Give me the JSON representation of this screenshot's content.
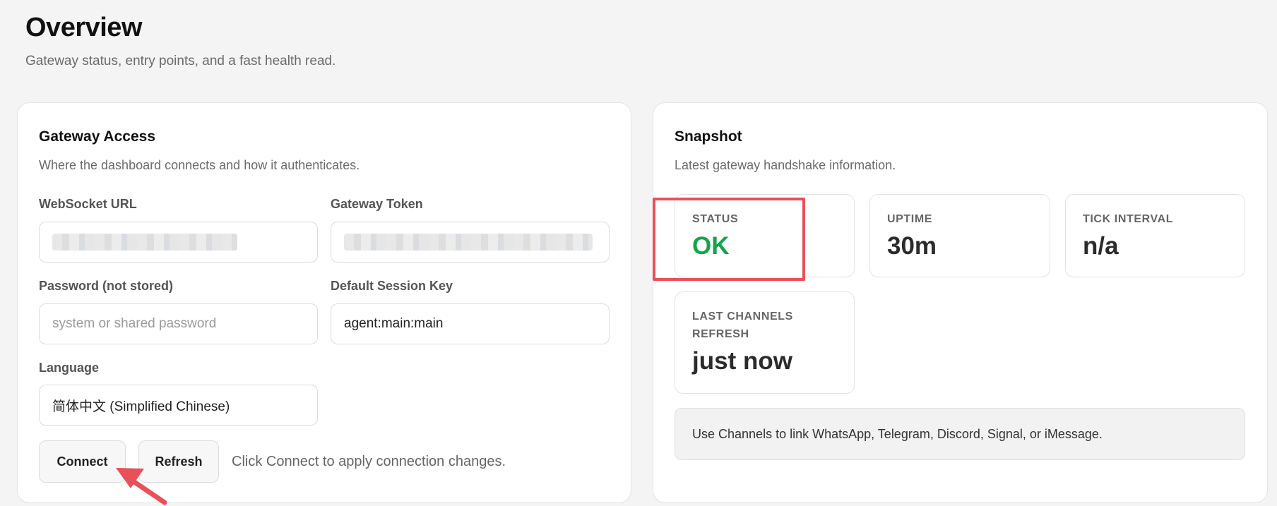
{
  "header": {
    "title": "Overview",
    "subtitle": "Gateway status, entry points, and a fast health read."
  },
  "access": {
    "title": "Gateway Access",
    "subtitle": "Where the dashboard connects and how it authenticates.",
    "websocket_label": "WebSocket URL",
    "token_label": "Gateway Token",
    "password_label": "Password (not stored)",
    "password_placeholder": "system or shared password",
    "session_label": "Default Session Key",
    "session_value": "agent:main:main",
    "language_label": "Language",
    "language_value": "简体中文 (Simplified Chinese)",
    "connect_label": "Connect",
    "refresh_label": "Refresh",
    "hint": "Click Connect to apply connection changes."
  },
  "snapshot": {
    "title": "Snapshot",
    "subtitle": "Latest gateway handshake information.",
    "stats": [
      {
        "label": "STATUS",
        "value": "OK"
      },
      {
        "label": "UPTIME",
        "value": "30m"
      },
      {
        "label": "TICK INTERVAL",
        "value": "n/a"
      },
      {
        "label": "LAST CHANNELS REFRESH",
        "value": "just now"
      }
    ],
    "callout": "Use Channels to link WhatsApp, Telegram, Discord, Signal, or iMessage."
  },
  "colors": {
    "status_ok": "#16a34a",
    "annotation": "#e8505b"
  }
}
